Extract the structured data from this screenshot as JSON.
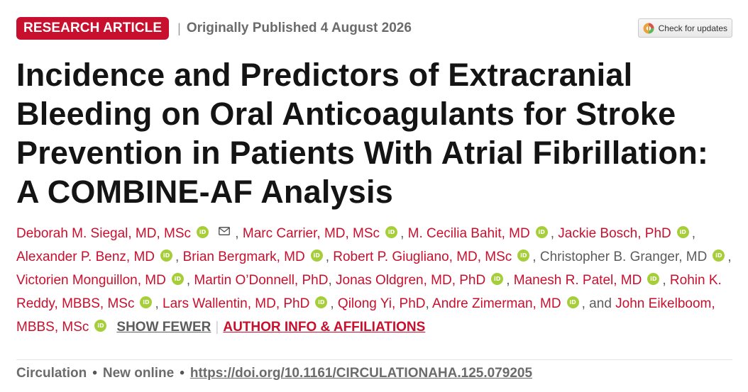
{
  "header": {
    "badge_label": "RESEARCH ARTICLE",
    "separator": "|",
    "published": "Originally Published 4 August 2026",
    "check_updates_label": "Check for updates"
  },
  "article": {
    "title": "Incidence and Predictors of Extracranial Bleeding on Oral Anticoagulants for Stroke Prevention in Patients With Atrial Fibrillation: A COMBINE-AF Analysis"
  },
  "authors": [
    {
      "name": "Deborah M. Siegal, MD, MSc"
    },
    {
      "name": "Marc Carrier, MD, MSc"
    },
    {
      "name": "M. Cecilia Bahit, MD"
    },
    {
      "name": "Jackie Bosch, PhD"
    },
    {
      "name": "Alexander P. Benz, MD"
    },
    {
      "name": "Brian Bergmark, MD"
    },
    {
      "name": "Robert P. Giugliano, MD, MSc"
    },
    {
      "name": "Christopher B. Granger, MD"
    },
    {
      "name": "Victorien Monguillon, MD"
    },
    {
      "name": "Martin O’Donnell, PhD"
    },
    {
      "name": "Jonas Oldgren, MD, PhD"
    },
    {
      "name": "Manesh R. Patel, MD"
    },
    {
      "name": "Rohin K. Reddy, MBBS, MSc"
    },
    {
      "name": "Lars Wallentin, MD, PhD"
    },
    {
      "name": "Qilong Yi, PhD"
    },
    {
      "name": "Andre Zimerman, MD"
    },
    {
      "name": "John Eikelboom, MBBS, MSc"
    }
  ],
  "author_controls": {
    "and_text": ", and",
    "show_fewer_label": "SHOW FEWER",
    "author_info_label": "AUTHOR INFO & AFFILIATIONS",
    "orcid_text": "iD"
  },
  "citation": {
    "journal": "Circulation",
    "status": "New online",
    "bullet": "•",
    "doi": "https://doi.org/10.1161/CIRCULATIONAHA.125.079205"
  },
  "colors": {
    "accent": "#c8102e",
    "orcid": "#a6ce39",
    "muted_text": "#6b6b6b"
  }
}
